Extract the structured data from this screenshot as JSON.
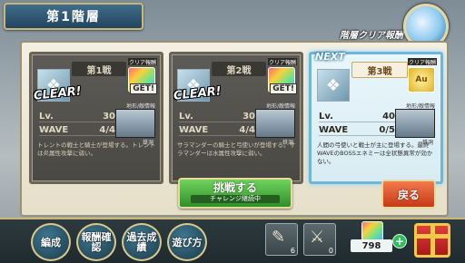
{
  "header": {
    "floor_title": "第1階層",
    "reward_label": "階層クリア報酬"
  },
  "battles": [
    {
      "title": "第1戦",
      "state": "cleared",
      "clear_stamp": "CLEAR!",
      "reward_tag": "クリア報酬",
      "get_stamp": "GET!",
      "terrain_label": "地形/敵情報",
      "terrain_name": "鉄洞",
      "lv_label": "Lv.",
      "lv": "30",
      "wave_label": "WAVE",
      "wave": "4/4",
      "description": "トレントの戦士と騎士が登場する。トレントは炎属性攻撃に弱い。"
    },
    {
      "title": "第2戦",
      "state": "cleared",
      "clear_stamp": "CLEAR!",
      "reward_tag": "クリア報酬",
      "get_stamp": "GET!",
      "terrain_label": "地形/敵情報",
      "terrain_name": "鉄洞",
      "lv_label": "Lv.",
      "lv": "30",
      "wave_label": "WAVE",
      "wave": "4/4",
      "description": "サラマンダーの騎士と弓使いが登場する。サラマンダーは水属性攻撃に弱い。"
    },
    {
      "title": "第3戦",
      "state": "next",
      "next_tag": "NEXT",
      "reward_tag": "クリア報酬",
      "reward_icon_text": "Au",
      "terrain_label": "地形/敵情報",
      "terrain_name": "鉄洞",
      "lv_label": "Lv.",
      "lv": "40",
      "wave_label": "WAVE",
      "wave": "0/5",
      "description": "人間の弓使いと戦士が主に登場する。最終WAVEのBOSSエネミーは全状態異常が効かない。"
    }
  ],
  "actions": {
    "challenge_label": "挑戦する",
    "challenge_sub": "チャレンジ継続中",
    "back_label": "戻る"
  },
  "bottom_nav": {
    "items": [
      "編成",
      "報酬確認",
      "過去成績",
      "遊び方"
    ],
    "slot1_count": "6",
    "slot2_count": "0",
    "gem_count": "798",
    "add_label": "+"
  },
  "colors": {
    "accent_gold": "#c9b778",
    "challenge_green": "#2f8f2a",
    "back_red": "#c53a16"
  }
}
